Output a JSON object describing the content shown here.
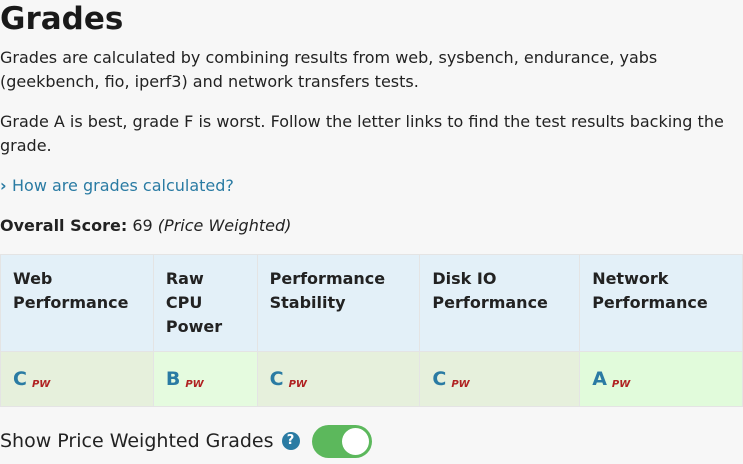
{
  "title": "Grades",
  "intro": "Grades are calculated by combining results from web, sysbench, endurance, yabs (geekbench, fio, iperf3) and network transfers tests.",
  "scale_note": "Grade A is best, grade F is worst. Follow the letter links to find the test results backing the grade.",
  "how_link": "How are grades calculated?",
  "overall": {
    "label": "Overall Score:",
    "value": "69",
    "note": "(Price Weighted)"
  },
  "columns": [
    {
      "header": "Web Performance",
      "grade": "C",
      "tag": "PW"
    },
    {
      "header": "Raw CPU Power",
      "grade": "B",
      "tag": "PW"
    },
    {
      "header": "Performance Stability",
      "grade": "C",
      "tag": "PW"
    },
    {
      "header": "Disk IO Performance",
      "grade": "C",
      "tag": "PW"
    },
    {
      "header": "Network Performance",
      "grade": "A",
      "tag": "PW"
    }
  ],
  "toggle": {
    "label": "Show Price Weighted Grades",
    "help_icon": "question-circle-icon",
    "on": true
  },
  "colors": {
    "link": "#2a7ba3",
    "header_bg": "#e3f0f8",
    "toggle_on": "#5cb85c",
    "pw_tag": "#b02121"
  }
}
